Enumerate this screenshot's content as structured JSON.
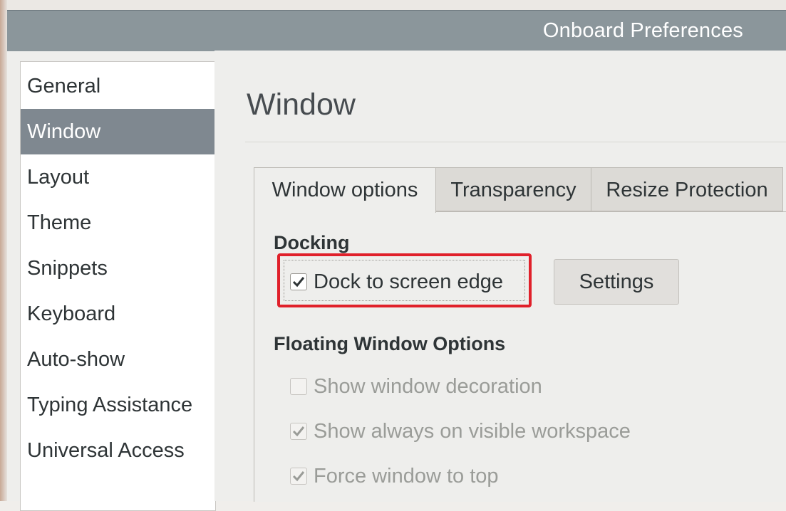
{
  "window": {
    "title": "Onboard Preferences"
  },
  "sidebar": {
    "items": [
      {
        "label": "General"
      },
      {
        "label": "Window",
        "selected": true
      },
      {
        "label": "Layout"
      },
      {
        "label": "Theme"
      },
      {
        "label": "Snippets"
      },
      {
        "label": "Keyboard"
      },
      {
        "label": "Auto-show"
      },
      {
        "label": "Typing Assistance"
      },
      {
        "label": "Universal Access"
      }
    ]
  },
  "main": {
    "title": "Window",
    "tabs": [
      {
        "label": "Window options",
        "active": true
      },
      {
        "label": "Transparency"
      },
      {
        "label": "Resize Protection"
      }
    ],
    "docking": {
      "heading": "Docking",
      "dock_to_edge": {
        "label": "Dock to screen edge",
        "checked": true
      },
      "settings_button": "Settings"
    },
    "floating": {
      "heading": "Floating Window Options",
      "options": [
        {
          "label": "Show window decoration",
          "checked": false,
          "enabled": false
        },
        {
          "label": "Show always on visible workspace",
          "checked": true,
          "enabled": false
        },
        {
          "label": "Force window to top",
          "checked": true,
          "enabled": false
        }
      ]
    }
  },
  "colors": {
    "titlebar": "#8b969b",
    "sidebar_selected": "#7f8890",
    "highlight": "#e0202a"
  }
}
